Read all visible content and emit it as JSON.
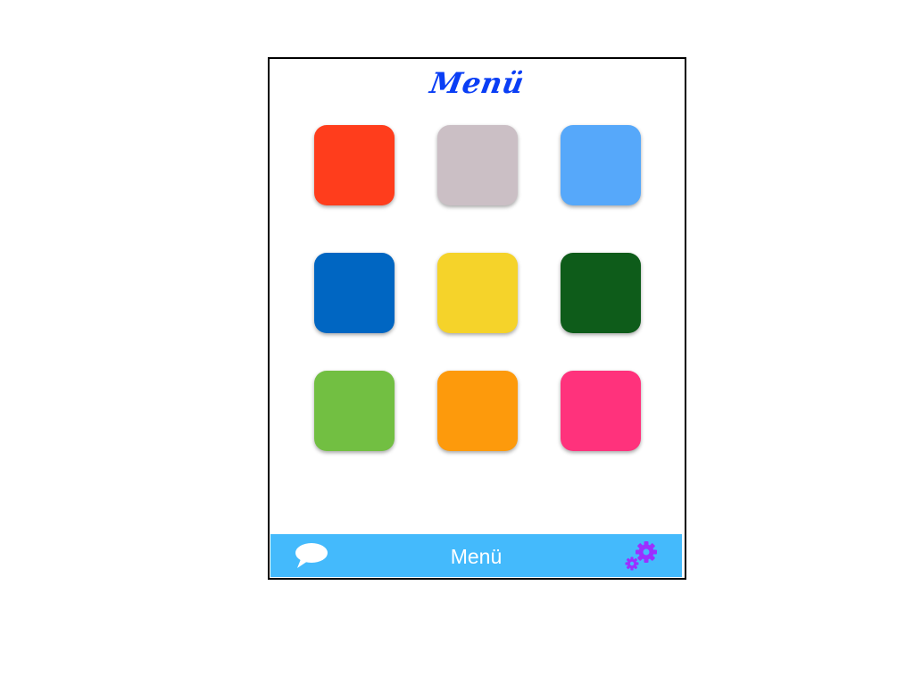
{
  "header": {
    "title": "Menü"
  },
  "grid": {
    "tiles": [
      {
        "name": "tile-red",
        "color": "#ff3d1c"
      },
      {
        "name": "tile-gray",
        "color": "#cbbfc5"
      },
      {
        "name": "tile-light-blue",
        "color": "#56a8fa"
      },
      {
        "name": "tile-blue",
        "color": "#0066c2"
      },
      {
        "name": "tile-yellow",
        "color": "#f5d32a"
      },
      {
        "name": "tile-dark-green",
        "color": "#0e5c1a"
      },
      {
        "name": "tile-green",
        "color": "#72bf42"
      },
      {
        "name": "tile-orange",
        "color": "#fd9a0c"
      },
      {
        "name": "tile-pink",
        "color": "#ff327c"
      }
    ]
  },
  "tab_bar": {
    "label": "Menü",
    "background": "#44bafc",
    "left_icon": "chat-bubble-icon",
    "right_icon": "gear-icon",
    "gear_color": "#9b30ff"
  },
  "colors": {
    "title": "#0a3ef5",
    "frame_border": "#000000"
  }
}
